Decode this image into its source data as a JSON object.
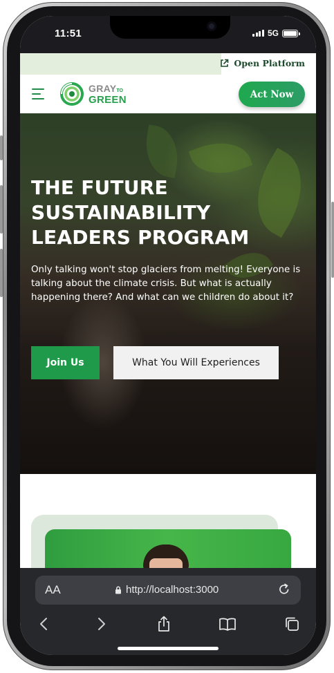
{
  "status_bar": {
    "time": "11:51",
    "network": "5G"
  },
  "top_strip": {
    "open_platform_label": "Open Platform",
    "open_platform_icon": "external-link-icon"
  },
  "navbar": {
    "menu_icon": "hamburger-menu-icon",
    "logo": {
      "word1": "GRAY",
      "word2": "TO",
      "word3": "GREEN"
    },
    "act_now_label": "Act Now"
  },
  "hero": {
    "title_line1": "THE FUTURE",
    "title_line2": "SUSTAINABILITY",
    "title_line3": "LEADERS PROGRAM",
    "subtitle": "Only talking won't stop glaciers from melting! Everyone is talking about the climate crisis. But what is actually happening there? And what can we children do about it?",
    "join_label": "Join Us",
    "experiences_label": "What You Will Experiences"
  },
  "safari": {
    "aa_label": "AA",
    "url": "http://localhost:3000",
    "tools": [
      "back-icon",
      "forward-icon",
      "share-icon",
      "bookmarks-icon",
      "tabs-icon"
    ]
  },
  "colors": {
    "brand_green": "#1f9a4a",
    "strip_tint": "#e3eedd",
    "dark_text": "#1d4a2c"
  }
}
